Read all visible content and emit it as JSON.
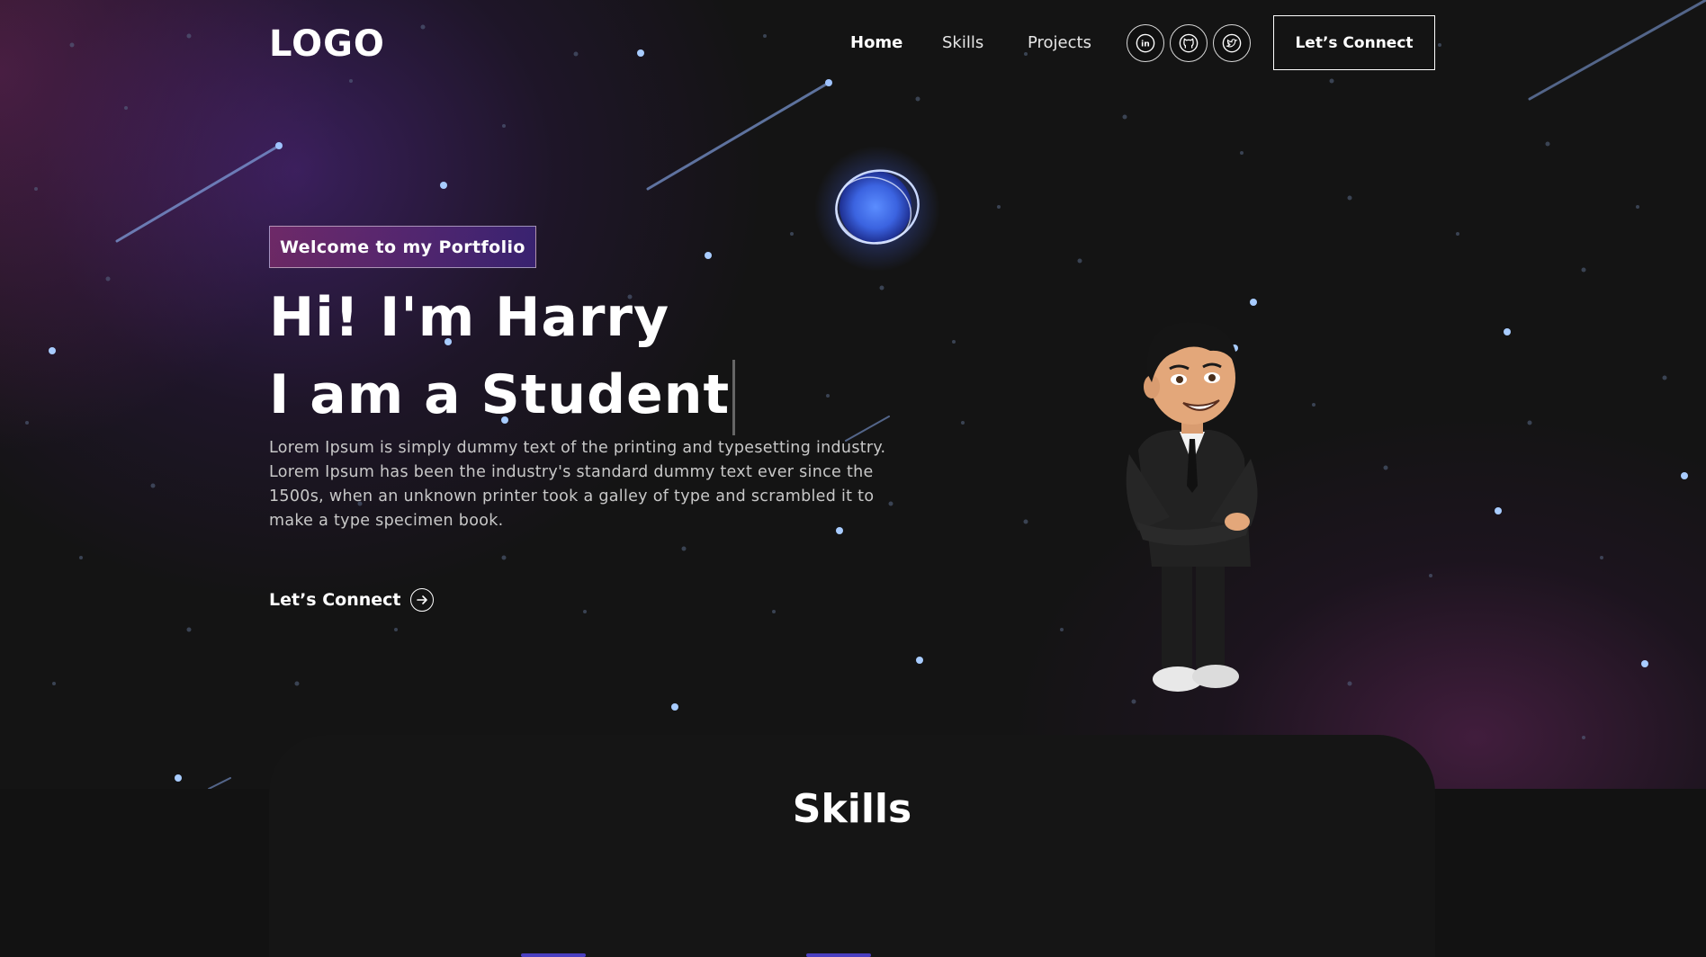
{
  "nav": {
    "logo": "LOGO",
    "links": [
      {
        "label": "Home",
        "active": true
      },
      {
        "label": "Skills",
        "active": false
      },
      {
        "label": "Projects",
        "active": false
      }
    ],
    "social": [
      {
        "icon": "linkedin-icon"
      },
      {
        "icon": "github-icon"
      },
      {
        "icon": "twitter-icon"
      }
    ],
    "connect_label": "Let’s Connect"
  },
  "hero": {
    "tagline": "Welcome to my Portfolio",
    "title_line1": "Hi! I'm Harry",
    "title_line2": "I am a Student",
    "description": "Lorem Ipsum is simply dummy text of the printing and typesetting industry. Lorem Ipsum has been the industry's standard dummy text ever since the 1500s, when an unknown printer took a galley of type and scrambled it to make a type specimen book.",
    "cta_label": "Let’s Connect",
    "cta_icon": "arrow-right-circle-icon"
  },
  "skills": {
    "title": "Skills"
  },
  "colors": {
    "background": "#121212",
    "accent_purple": "#4a2fbd",
    "accent_pink": "#aa367c"
  }
}
